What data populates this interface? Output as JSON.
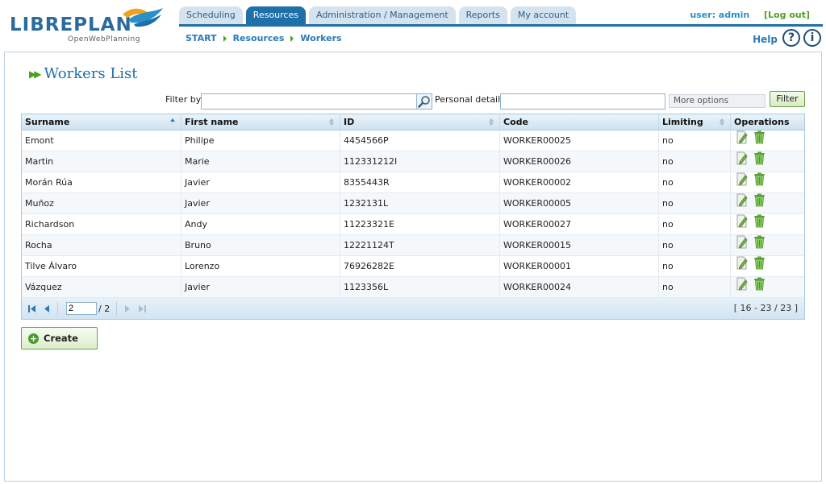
{
  "header": {
    "logo_text_a": "LIBRE",
    "logo_text_b": "PLAN",
    "logo_sub": "OpenWebPlanning",
    "tabs": [
      {
        "label": "Scheduling",
        "active": false
      },
      {
        "label": "Resources",
        "active": true
      },
      {
        "label": "Administration / Management",
        "active": false
      },
      {
        "label": "Reports",
        "active": false
      },
      {
        "label": "My account",
        "active": false
      }
    ],
    "user_label": "user: admin",
    "logout_label": "[Log out]",
    "help_label": "Help"
  },
  "breadcrumb": [
    "START",
    "Resources",
    "Workers"
  ],
  "page": {
    "title": "Workers List",
    "filter_label": "Filter by",
    "filter_value": "",
    "personal_label": "Personal details",
    "personal_value": "",
    "more_options": "More options",
    "filter_button": "Filter",
    "create_button": "Create"
  },
  "table": {
    "columns": [
      "Surname",
      "First name",
      "ID",
      "Code",
      "Limiting",
      "Operations"
    ],
    "rows": [
      [
        "Emont",
        "Philipe",
        "4454566P",
        "WORKER00025",
        "no"
      ],
      [
        "Martin",
        "Marie",
        "112331212I",
        "WORKER00026",
        "no"
      ],
      [
        "Morán Rúa",
        "Javier",
        "8355443R",
        "WORKER00002",
        "no"
      ],
      [
        "Muñoz",
        "Javier",
        "1232131L",
        "WORKER00005",
        "no"
      ],
      [
        "Richardson",
        "Andy",
        "11223321E",
        "WORKER00027",
        "no"
      ],
      [
        "Rocha",
        "Bruno",
        "12221124T",
        "WORKER00015",
        "no"
      ],
      [
        "Tilve Álvaro",
        "Lorenzo",
        "76926282E",
        "WORKER00001",
        "no"
      ],
      [
        "Vázquez",
        "Javier",
        "1123356L",
        "WORKER00024",
        "no"
      ]
    ]
  },
  "paging": {
    "current_page": "2",
    "total_pages": "/ 2",
    "range": "[ 16 - 23 / 23 ]"
  },
  "colors": {
    "brand_blue": "#1f6fa8",
    "accent_green": "#4ea020"
  }
}
